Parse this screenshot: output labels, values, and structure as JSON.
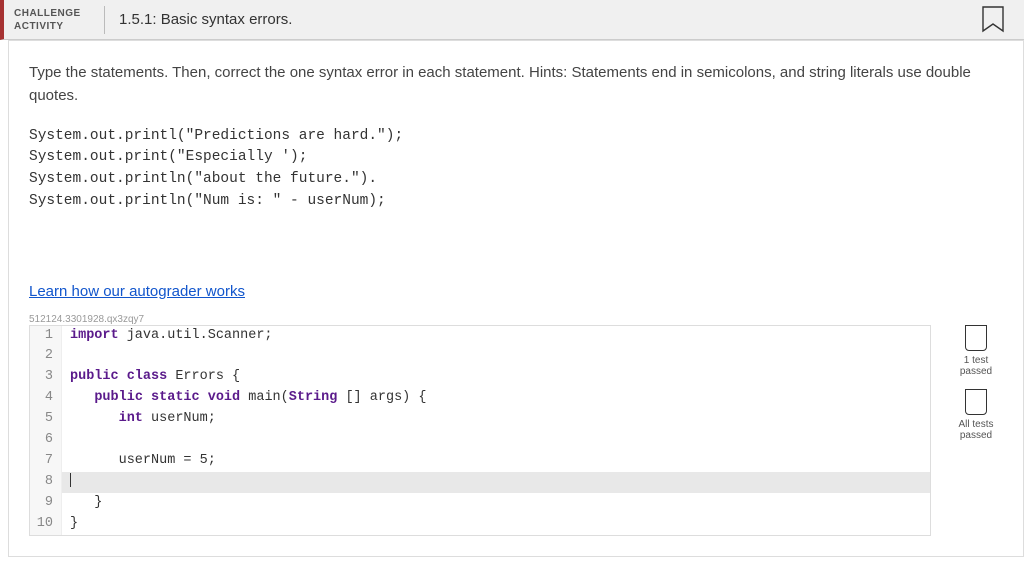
{
  "header": {
    "badge_line1": "CHALLENGE",
    "badge_line2": "ACTIVITY",
    "title": "1.5.1: Basic syntax errors."
  },
  "instructions": "Type the statements. Then, correct the one syntax error in each statement. Hints: Statements end in semicolons, and string literals use double quotes.",
  "code_sample": [
    "System.out.printl(\"Predictions are hard.\");",
    "System.out.print(\"Especially ');",
    "System.out.println(\"about the future.\").",
    "System.out.println(\"Num is: \" - userNum);"
  ],
  "autograder_link": "Learn how our autograder works",
  "hash": "512124.3301928.qx3zqy7",
  "editor": [
    {
      "n": 1,
      "text": "import java.util.Scanner;",
      "tokens": [
        [
          "kw",
          "import"
        ],
        [
          "",
          " java.util.Scanner;"
        ]
      ]
    },
    {
      "n": 2,
      "text": ""
    },
    {
      "n": 3,
      "text": "public class Errors {",
      "tokens": [
        [
          "kw",
          "public class"
        ],
        [
          "",
          " Errors {"
        ]
      ]
    },
    {
      "n": 4,
      "text": "   public static void main(String [] args) {",
      "tokens": [
        [
          "",
          "   "
        ],
        [
          "kw",
          "public static void"
        ],
        [
          "",
          " main("
        ],
        [
          "typ",
          "String"
        ],
        [
          "",
          " [] args) {"
        ]
      ]
    },
    {
      "n": 5,
      "text": "      int userNum;",
      "tokens": [
        [
          "",
          "      "
        ],
        [
          "kw",
          "int"
        ],
        [
          "",
          " userNum;"
        ]
      ]
    },
    {
      "n": 6,
      "text": ""
    },
    {
      "n": 7,
      "text": "      userNum = 5;"
    },
    {
      "n": 8,
      "text": "",
      "current": true
    },
    {
      "n": 9,
      "text": "   }"
    },
    {
      "n": 10,
      "text": "}"
    }
  ],
  "side": {
    "box1_line1": "1 test",
    "box1_line2": "passed",
    "box2_line1": "All tests",
    "box2_line2": "passed"
  }
}
